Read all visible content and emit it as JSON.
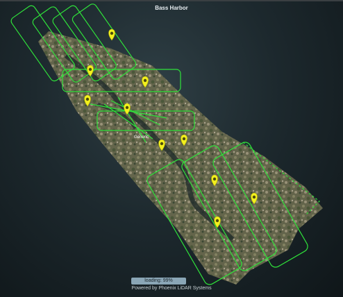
{
  "viewer": {
    "title": "Bass Harbor",
    "marker_label": "Generic",
    "marker_count": 9,
    "loading_text": "loading: 99%",
    "loading_progress": 0.99,
    "footer": "Powered by Phoenix LiDAR Systems"
  },
  "colors": {
    "flight_line": "#2fe23a",
    "marker": "#f3f01e",
    "loading_bar": "#8aa6b6"
  },
  "icons": [
    "map-pin-icon"
  ]
}
